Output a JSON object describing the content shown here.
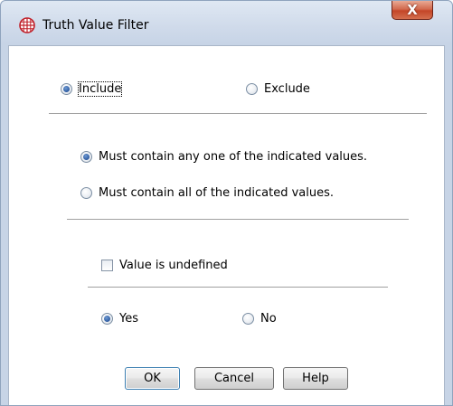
{
  "window": {
    "title": "Truth Value Filter",
    "title_icon": "globe-grid-icon",
    "close_glyph": "X",
    "accent_close": "#c44628"
  },
  "mode": {
    "include_label": "Include",
    "exclude_label": "Exclude",
    "selected": "include"
  },
  "match": {
    "any_label": "Must contain any one of the indicated values.",
    "all_label": "Must contain all of the indicated values.",
    "selected": "any"
  },
  "undefined": {
    "label": "Value is undefined",
    "checked": false
  },
  "answer": {
    "yes_label": "Yes",
    "no_label": "No",
    "selected": "yes"
  },
  "buttons": {
    "ok": "OK",
    "cancel": "Cancel",
    "help": "Help"
  }
}
